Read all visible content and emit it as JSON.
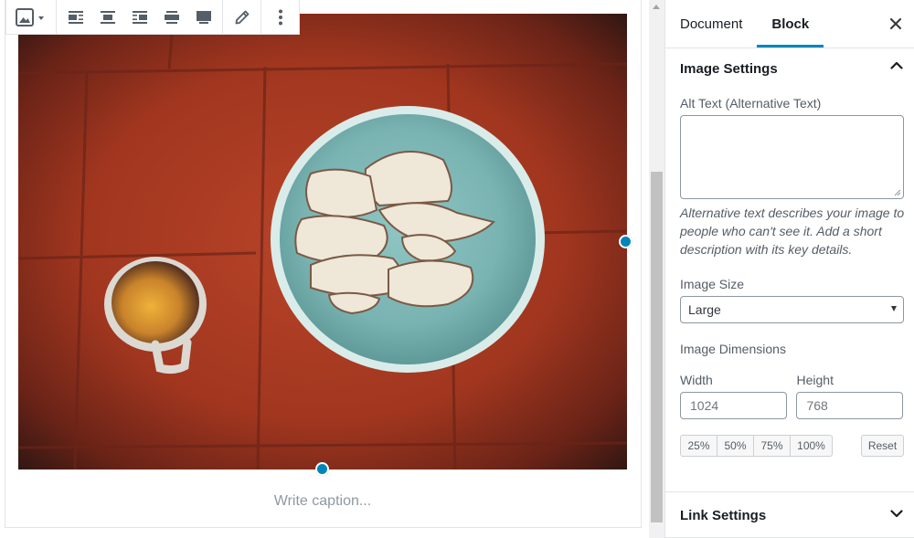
{
  "editor": {
    "caption_placeholder": "Write caption...",
    "toolbar": {
      "block_type_icon": "image-icon",
      "align_icons": [
        "align-left-icon",
        "align-center-icon",
        "align-right-icon",
        "align-wide-icon",
        "align-full-icon"
      ],
      "edit_icon": "pencil-icon",
      "more_icon": "more-vertical-icon"
    },
    "image": {
      "description": "photo",
      "palette": {
        "tiles": "#a33a22",
        "bowl": "#8fc1bd",
        "coconut": "#efe6d6",
        "mug": "#d8d3cc"
      }
    },
    "handle_color": "#0085ba"
  },
  "sidebar": {
    "tabs": [
      {
        "label": "Document",
        "active": false
      },
      {
        "label": "Block",
        "active": true
      }
    ],
    "accent_color": "#0085ba",
    "image_settings": {
      "title": "Image Settings",
      "alt_label": "Alt Text (Alternative Text)",
      "alt_value": "",
      "alt_help": "Alternative text describes your image to people who can't see it. Add a short description with its key details.",
      "size_label": "Image Size",
      "size_value": "Large",
      "dimensions_label": "Image Dimensions",
      "width_label": "Width",
      "width_value": "1024",
      "height_label": "Height",
      "height_value": "768",
      "percent_buttons": [
        "25%",
        "50%",
        "75%",
        "100%"
      ],
      "reset_label": "Reset"
    },
    "link_settings": {
      "title": "Link Settings"
    }
  }
}
